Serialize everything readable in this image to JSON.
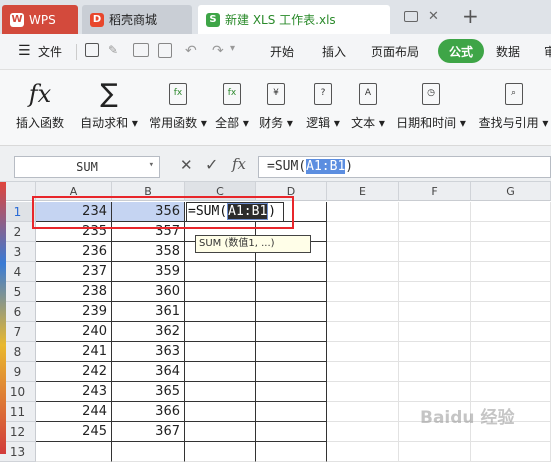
{
  "tabs": {
    "wps": "WPS",
    "shop": "稻壳商城",
    "file": "新建 XLS 工作表.xls",
    "add": "+"
  },
  "menu": {
    "file": "文件",
    "start": "开始",
    "insert": "插入",
    "layout": "页面布局",
    "formula": "公式",
    "data": "数据",
    "cut": "审"
  },
  "ribbon": {
    "insert_func": "插入函数",
    "autosum": "自动求和",
    "common": "常用函数",
    "all": "全部",
    "finance": "财务",
    "logic": "逻辑",
    "text": "文本",
    "datetime": "日期和时间",
    "lookup": "查找与引用",
    "fx": "fx",
    "sigma": "∑"
  },
  "formula_bar": {
    "name": "SUM",
    "fx": "fx",
    "cancel": "✕",
    "confirm": "✓",
    "formula_prefix": "=SUM(",
    "formula_ref": "A1:B1",
    "formula_suffix": ")"
  },
  "columns": [
    "A",
    "B",
    "C",
    "D",
    "E",
    "F",
    "G"
  ],
  "rows": [
    "1",
    "2",
    "3",
    "4",
    "5",
    "6",
    "7",
    "8",
    "9",
    "10",
    "11",
    "12",
    "13"
  ],
  "col_a": [
    "234",
    "235",
    "236",
    "237",
    "238",
    "239",
    "240",
    "241",
    "242",
    "243",
    "244",
    "245",
    ""
  ],
  "col_b": [
    "356",
    "357",
    "358",
    "359",
    "360",
    "361",
    "362",
    "363",
    "364",
    "365",
    "366",
    "367",
    ""
  ],
  "edit": {
    "prefix": "=SUM(",
    "ref": "A1:B1",
    "suffix": ")"
  },
  "tooltip": "SUM (数值1, ...)",
  "watermark": "Baidu 经验",
  "colors": {
    "accent": "#3ea547",
    "highlight": "#c5d4f2",
    "annot": "#e8262b"
  }
}
